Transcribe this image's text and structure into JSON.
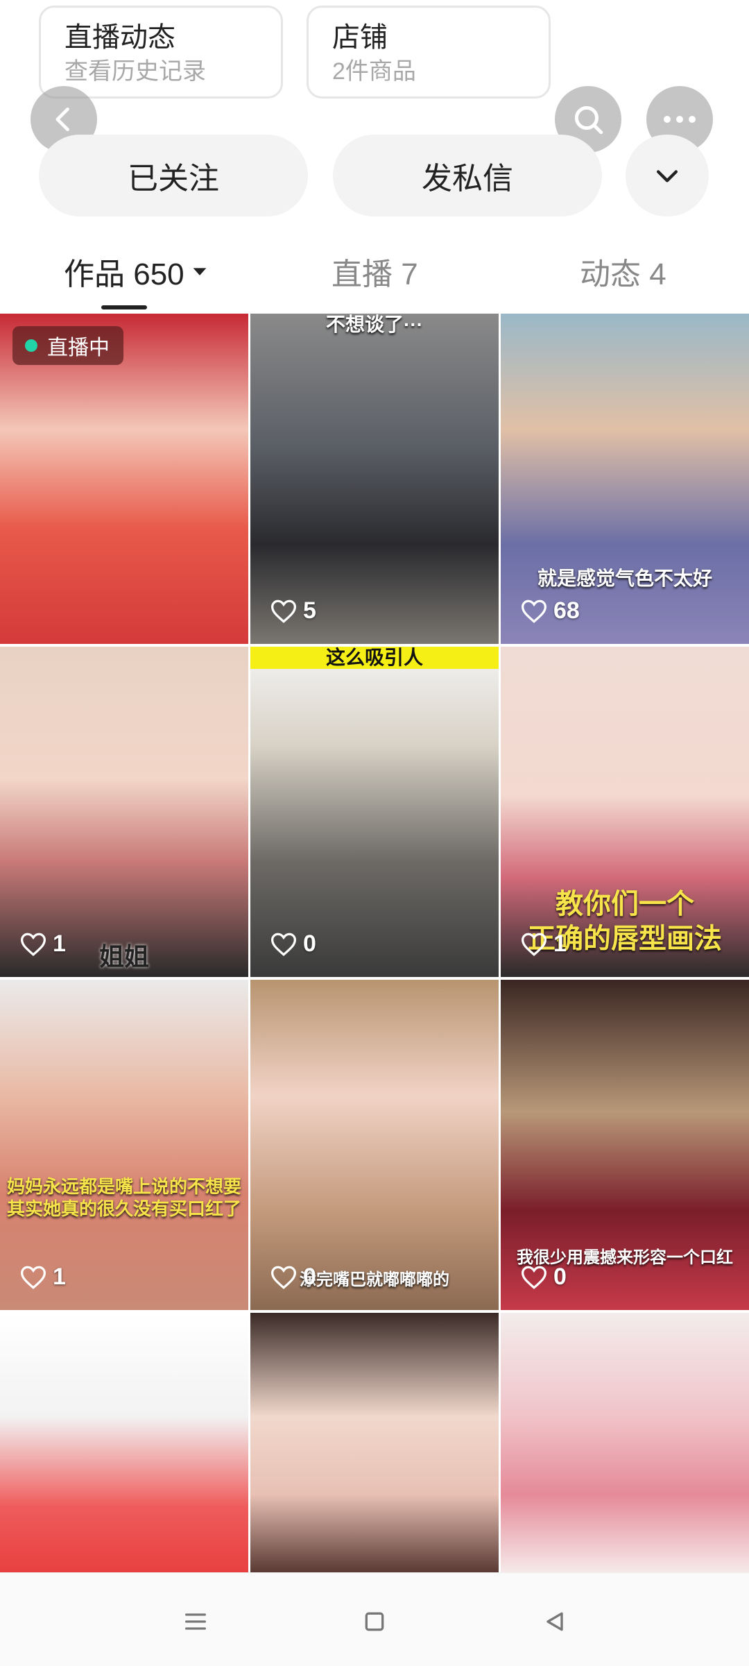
{
  "header": {
    "live_card": {
      "title": "直播动态",
      "subtitle": "查看历史记录"
    },
    "shop_card": {
      "title": "店铺",
      "subtitle": "2件商品"
    }
  },
  "actions": {
    "followed_label": "已关注",
    "message_label": "发私信"
  },
  "tabs": [
    {
      "label": "作品 650",
      "active": true
    },
    {
      "label": "直播 7",
      "active": false
    },
    {
      "label": "动态 4",
      "active": false
    }
  ],
  "grid": [
    {
      "badge": "直播中",
      "caption": "",
      "likes": ""
    },
    {
      "top_text": "不想谈了···",
      "likes": "5"
    },
    {
      "caption": "就是感觉气色不太好",
      "likes": "68"
    },
    {
      "caption": "姐姐",
      "likes": "1"
    },
    {
      "top_text": "这么吸引人",
      "likes": "0"
    },
    {
      "caption": "教你们一个\n正确的唇型画法",
      "likes": "1"
    },
    {
      "caption": "妈妈永远都是嘴上说的不想要\n其实她真的很久没有买口红了",
      "likes": "1"
    },
    {
      "caption": "涂完嘴巴就嘟嘟嘟的",
      "likes": "0"
    },
    {
      "caption": "我很少用震撼来形容一个口红",
      "likes": "0"
    },
    {
      "likes": ""
    },
    {
      "likes": ""
    },
    {
      "likes": ""
    }
  ],
  "icons": {
    "back": "chevron-left-icon",
    "search": "search-icon",
    "more": "more-icon",
    "expand": "chevron-down-icon",
    "heart": "heart-icon"
  },
  "colors": {
    "live_dot": "#22d3a7",
    "tab_active": "#222222",
    "tab_inactive": "#888888"
  }
}
